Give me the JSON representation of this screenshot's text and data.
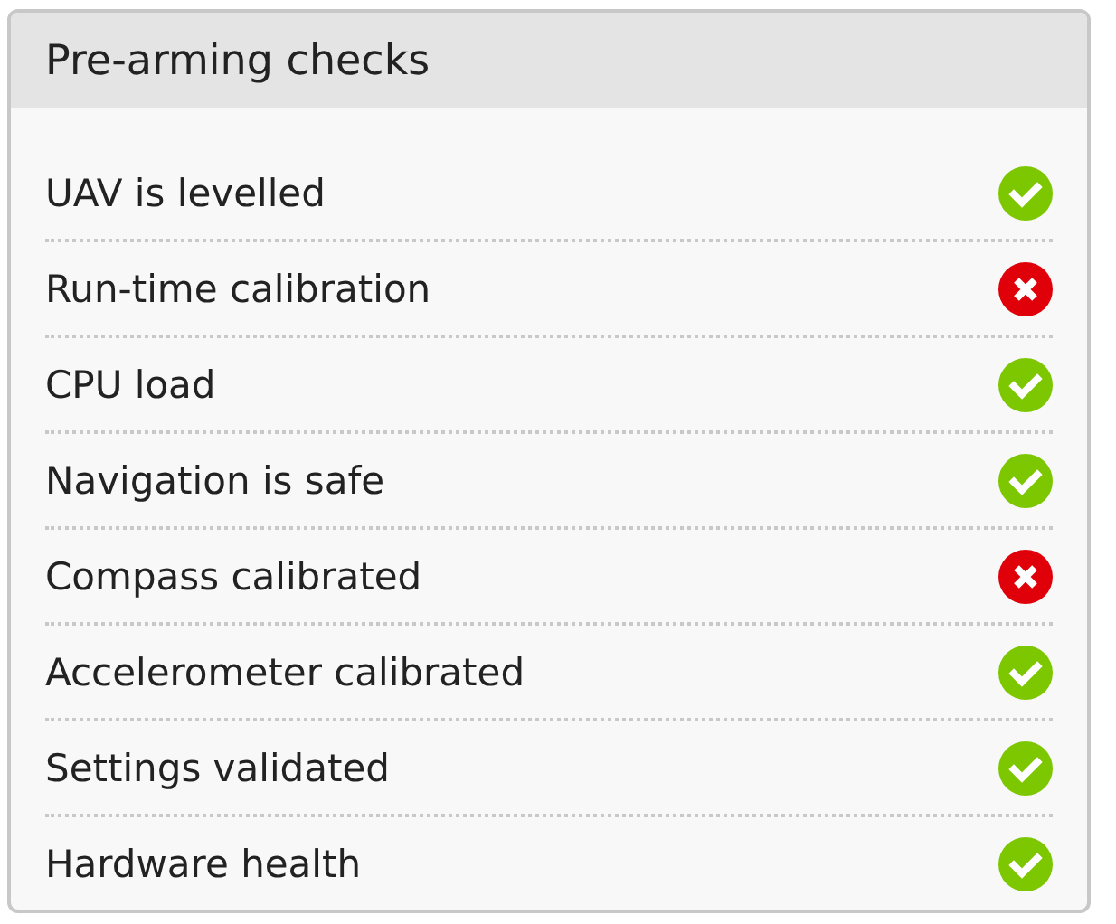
{
  "panel": {
    "title": "Pre-arming checks"
  },
  "checks": [
    {
      "label": "UAV is levelled",
      "passed": true
    },
    {
      "label": "Run-time calibration",
      "passed": false
    },
    {
      "label": "CPU load",
      "passed": true
    },
    {
      "label": "Navigation is safe",
      "passed": true
    },
    {
      "label": "Compass calibrated",
      "passed": false
    },
    {
      "label": "Accelerometer calibrated",
      "passed": true
    },
    {
      "label": "Settings validated",
      "passed": true
    },
    {
      "label": "Hardware health",
      "passed": true
    }
  ]
}
